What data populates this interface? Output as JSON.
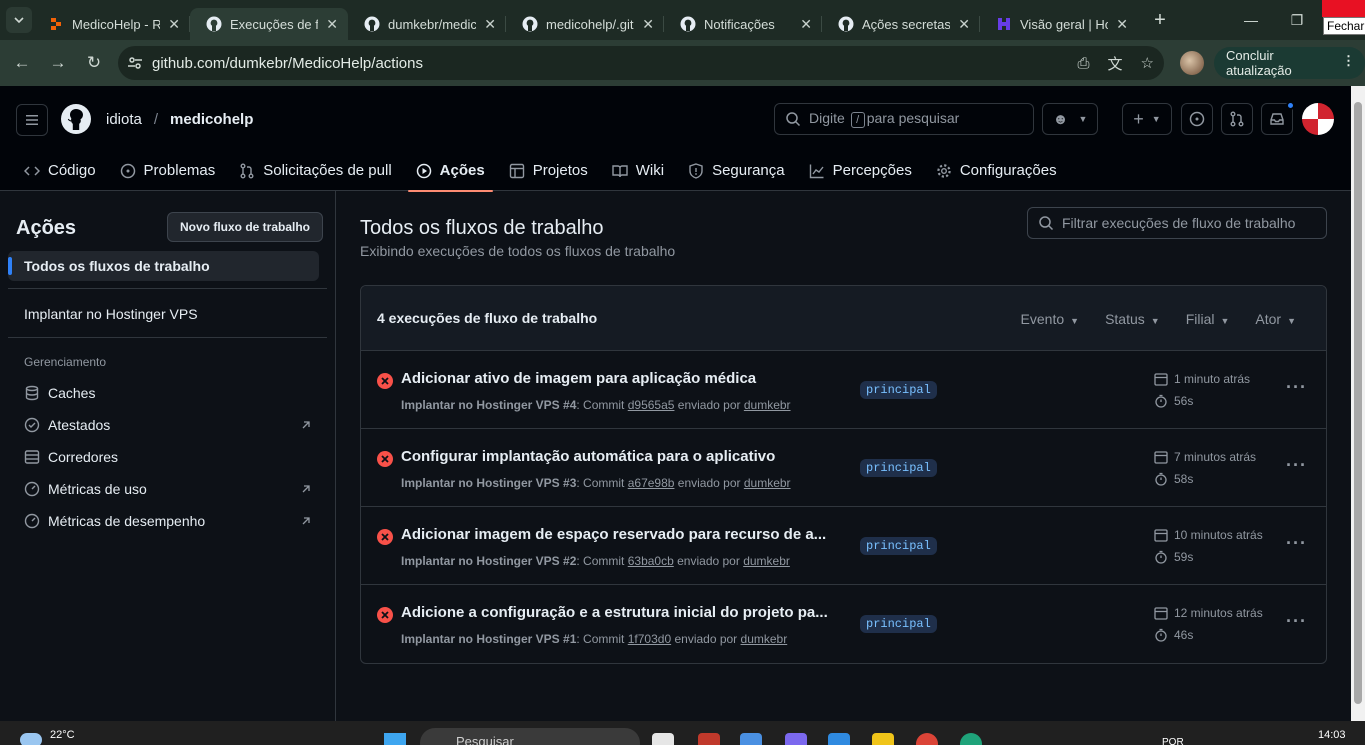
{
  "browser": {
    "tabs": [
      {
        "title": "MedicoHelp - Re",
        "icon": "replit-icon",
        "active": false
      },
      {
        "title": "Execuções de flu",
        "icon": "github-icon",
        "active": true
      },
      {
        "title": "dumkebr/medic",
        "icon": "github-icon",
        "active": false
      },
      {
        "title": "medicohelp/.gith",
        "icon": "github-icon",
        "active": false
      },
      {
        "title": "Notificações",
        "icon": "github-icon",
        "active": false
      },
      {
        "title": "Ações secretas",
        "icon": "github-icon",
        "active": false
      },
      {
        "title": "Visão geral | Ho",
        "icon": "hostinger-icon",
        "active": false
      }
    ],
    "close_tooltip": "Fechar",
    "url": "github.com/dumkebr/MedicoHelp/actions",
    "update_button": "Concluir atualização"
  },
  "header": {
    "owner": "idiota",
    "separator": "/",
    "repo": "medicohelp",
    "search_pre": "Digite",
    "search_key": "/",
    "search_post": "para pesquisar"
  },
  "repo_nav": [
    {
      "label": "Código",
      "icon": "code-icon",
      "active": false
    },
    {
      "label": "Problemas",
      "icon": "issue-icon",
      "active": false
    },
    {
      "label": "Solicitações de pull",
      "icon": "pull-request-icon",
      "active": false
    },
    {
      "label": "Ações",
      "icon": "play-icon",
      "active": true
    },
    {
      "label": "Projetos",
      "icon": "table-icon",
      "active": false
    },
    {
      "label": "Wiki",
      "icon": "book-icon",
      "active": false
    },
    {
      "label": "Segurança",
      "icon": "shield-icon",
      "active": false
    },
    {
      "label": "Percepções",
      "icon": "graph-icon",
      "active": false
    },
    {
      "label": "Configurações",
      "icon": "gear-icon",
      "active": false
    }
  ],
  "sidebar": {
    "title": "Ações",
    "new_workflow": "Novo fluxo de trabalho",
    "all_workflows": "Todos os fluxos de trabalho",
    "workflow": "Implantar no Hostinger VPS",
    "management_heading": "Gerenciamento",
    "management_items": [
      {
        "label": "Caches",
        "icon": "database-icon",
        "external": false
      },
      {
        "label": "Atestados",
        "icon": "verified-icon",
        "external": true
      },
      {
        "label": "Corredores",
        "icon": "server-icon",
        "external": false
      },
      {
        "label": "Métricas de uso",
        "icon": "meter-icon",
        "external": true
      },
      {
        "label": "Métricas de desempenho",
        "icon": "meter-icon",
        "external": true
      }
    ]
  },
  "main": {
    "title": "Todos os fluxos de trabalho",
    "subtitle": "Exibindo execuções de todos os fluxos de trabalho",
    "filter_placeholder": "Filtrar execuções de fluxo de trabalho",
    "runs_count": "4 execuções de fluxo de trabalho",
    "filters": [
      "Evento",
      "Status",
      "Filial",
      "Ator"
    ],
    "runs": [
      {
        "title": "Adicionar ativo de imagem para aplicação médica",
        "workflow": "Implantar no Hostinger VPS #4",
        "commit_label": "Commit",
        "commit": "d9565a5",
        "pushed_by": "enviado por",
        "actor": "dumkebr",
        "branch": "principal",
        "when": "1 minuto atrás",
        "duration": "56s",
        "status": "failure"
      },
      {
        "title": "Configurar implantação automática para o aplicativo",
        "workflow": "Implantar no Hostinger VPS #3",
        "commit_label": "Commit",
        "commit": "a67e98b",
        "pushed_by": "enviado por",
        "actor": "dumkebr",
        "branch": "principal",
        "when": "7 minutos atrás",
        "duration": "58s",
        "status": "failure"
      },
      {
        "title": "Adicionar imagem de espaço reservado para recurso de a...",
        "workflow": "Implantar no Hostinger VPS #2",
        "commit_label": "Commit",
        "commit": "63ba0cb",
        "pushed_by": "enviado por",
        "actor": "dumkebr",
        "branch": "principal",
        "when": "10 minutos atrás",
        "duration": "59s",
        "status": "failure"
      },
      {
        "title": "Adicione a configuração e a estrutura inicial do projeto pa...",
        "workflow": "Implantar no Hostinger VPS #1",
        "commit_label": "Commit",
        "commit": "1f703d0",
        "pushed_by": "enviado por",
        "actor": "dumkebr",
        "branch": "principal",
        "when": "12 minutos atrás",
        "duration": "46s",
        "status": "failure"
      }
    ]
  },
  "taskbar": {
    "temperature": "22°C",
    "search": "Pesquisar",
    "language": "POR",
    "time": "14:03"
  },
  "colors": {
    "background": "#0d1117",
    "failure": "#f85149",
    "accent_tab": "#fd8c73",
    "branch_text": "#79c0ff"
  }
}
